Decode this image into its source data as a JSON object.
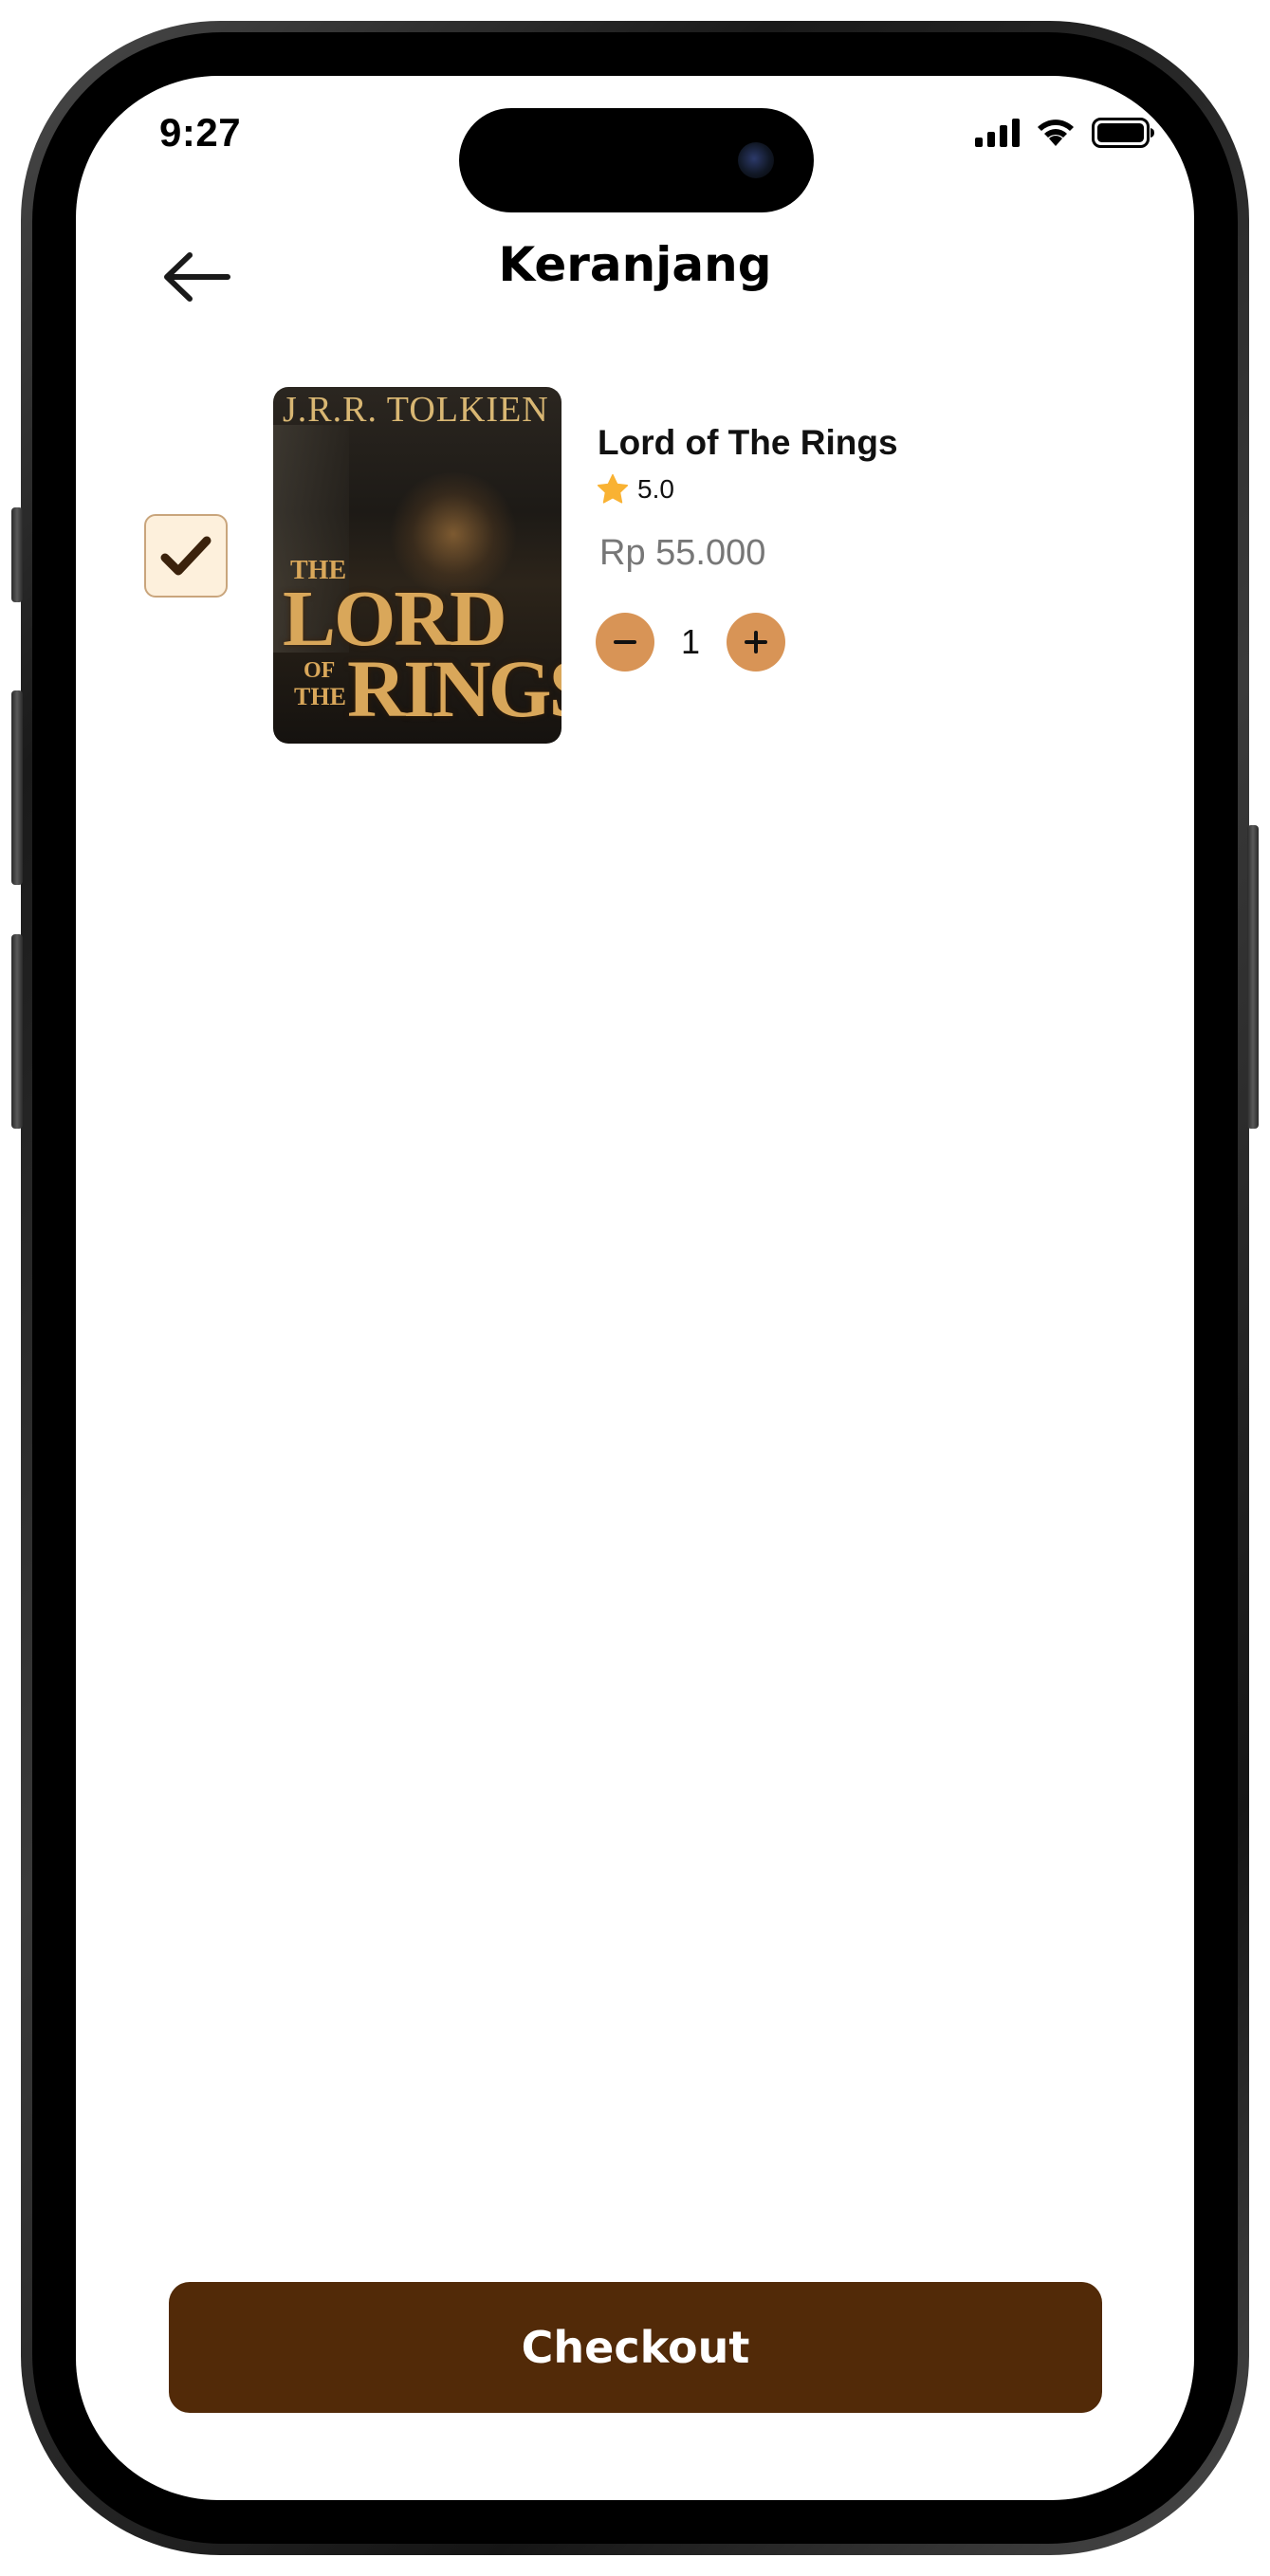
{
  "status_bar": {
    "time": "9:27"
  },
  "header": {
    "title": "Keranjang",
    "back_icon": "arrow-left-icon"
  },
  "cart": {
    "items": [
      {
        "checked": true,
        "title": "Lord of The Rings",
        "rating": "5.0",
        "price": "Rp 55.000",
        "quantity": "1",
        "cover": {
          "author": "J.R.R. TOLKIEN",
          "line1": "THE",
          "line2": "LORD",
          "line3": "OF",
          "line4": "THE",
          "line5": "RINGS"
        }
      }
    ]
  },
  "checkout": {
    "label": "Checkout"
  },
  "colors": {
    "accent": "#d89456",
    "checkout_bg": "#522a08",
    "checkbox_bg": "#fdf0dc",
    "star": "#f9b233",
    "price_text": "#777777"
  }
}
